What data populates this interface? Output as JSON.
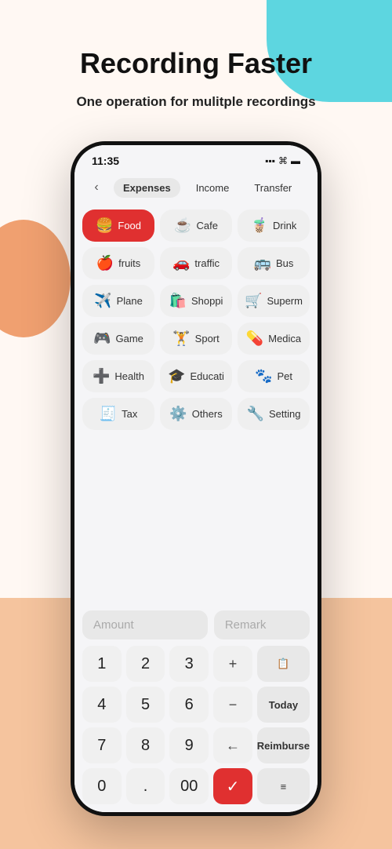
{
  "page": {
    "title": "Recording Faster",
    "subtitle": "One operation for mulitple recordings"
  },
  "status_bar": {
    "time": "11:35",
    "signal": "▪▪▪",
    "wifi": "wifi",
    "battery": "battery"
  },
  "tabs": [
    {
      "label": "Expenses",
      "active": true
    },
    {
      "label": "Income",
      "active": false
    },
    {
      "label": "Transfer",
      "active": false
    }
  ],
  "categories": [
    {
      "icon": "🍔",
      "label": "Food",
      "selected": true
    },
    {
      "icon": "☕",
      "label": "Cafe",
      "selected": false
    },
    {
      "icon": "🧋",
      "label": "Drink",
      "selected": false
    },
    {
      "icon": "🍎",
      "label": "fruits",
      "selected": false
    },
    {
      "icon": "🚗",
      "label": "traffic",
      "selected": false
    },
    {
      "icon": "🚌",
      "label": "Bus",
      "selected": false
    },
    {
      "icon": "✈️",
      "label": "Plane",
      "selected": false
    },
    {
      "icon": "🛍️",
      "label": "Shoppi",
      "selected": false
    },
    {
      "icon": "🛒",
      "label": "Superm",
      "selected": false
    },
    {
      "icon": "🎮",
      "label": "Game",
      "selected": false
    },
    {
      "icon": "🏋️",
      "label": "Sport",
      "selected": false
    },
    {
      "icon": "💊",
      "label": "Medica",
      "selected": false
    },
    {
      "icon": "➕",
      "label": "Health",
      "selected": false
    },
    {
      "icon": "🎓",
      "label": "Educati",
      "selected": false
    },
    {
      "icon": "🐾",
      "label": "Pet",
      "selected": false
    },
    {
      "icon": "🧾",
      "label": "Tax",
      "selected": false
    },
    {
      "icon": "⚙️",
      "label": "Others",
      "selected": false
    },
    {
      "icon": "🔧",
      "label": "Setting",
      "selected": false
    }
  ],
  "amount_placeholder": "Amount",
  "remark_placeholder": "Remark",
  "numpad": {
    "buttons": [
      {
        "label": "1",
        "type": "num"
      },
      {
        "label": "2",
        "type": "num"
      },
      {
        "label": "3",
        "type": "num"
      },
      {
        "label": "+",
        "type": "special"
      },
      {
        "label": "📋",
        "type": "action-icon"
      },
      {
        "label": "4",
        "type": "num"
      },
      {
        "label": "5",
        "type": "num"
      },
      {
        "label": "6",
        "type": "num"
      },
      {
        "label": "−",
        "type": "special"
      },
      {
        "label": "Today",
        "type": "action"
      },
      {
        "label": "7",
        "type": "num"
      },
      {
        "label": "8",
        "type": "num"
      },
      {
        "label": "9",
        "type": "num"
      },
      {
        "label": "←",
        "type": "special"
      },
      {
        "label": "Reimburse",
        "type": "action"
      },
      {
        "label": "0",
        "type": "num"
      },
      {
        "label": ".",
        "type": "num"
      },
      {
        "label": "00",
        "type": "num"
      },
      {
        "label": "✓",
        "type": "confirm"
      },
      {
        "label": "≡≡",
        "type": "action-icon"
      }
    ]
  }
}
